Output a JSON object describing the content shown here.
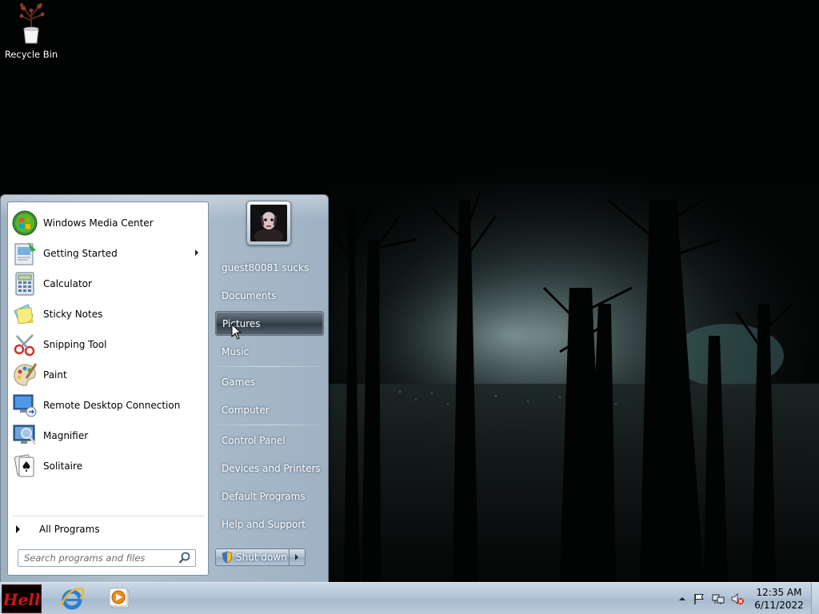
{
  "desktop": {
    "icons": [
      {
        "label": "Recycle Bin",
        "icon": "recycle-bin-icon"
      }
    ]
  },
  "start_menu": {
    "programs": [
      {
        "label": "Windows Media Center",
        "icon": "windows-media-center-icon"
      },
      {
        "label": "Getting Started",
        "icon": "getting-started-icon",
        "has_submenu": true
      },
      {
        "label": "Calculator",
        "icon": "calculator-icon"
      },
      {
        "label": "Sticky Notes",
        "icon": "sticky-notes-icon"
      },
      {
        "label": "Snipping Tool",
        "icon": "snipping-tool-icon"
      },
      {
        "label": "Paint",
        "icon": "paint-icon"
      },
      {
        "label": "Remote Desktop Connection",
        "icon": "remote-desktop-icon"
      },
      {
        "label": "Magnifier",
        "icon": "magnifier-icon"
      },
      {
        "label": "Solitaire",
        "icon": "solitaire-icon"
      }
    ],
    "all_programs_label": "All Programs",
    "search_placeholder": "Search programs and files",
    "user_name": "guest80081 sucks",
    "places": [
      {
        "label": "Documents"
      },
      {
        "label": "Pictures",
        "hovered": true
      },
      {
        "label": "Music"
      },
      {
        "label": "Games"
      },
      {
        "label": "Computer"
      },
      {
        "label": "Control Panel"
      },
      {
        "label": "Devices and Printers"
      },
      {
        "label": "Default Programs"
      },
      {
        "label": "Help and Support"
      }
    ],
    "shutdown_label": "Shut down"
  },
  "taskbar": {
    "start_button_text": "Hell",
    "pinned": [
      {
        "icon": "internet-explorer-icon"
      },
      {
        "icon": "windows-media-player-icon"
      }
    ],
    "tray": {
      "icons": [
        "show-hidden-icons-arrow",
        "action-center-flag-icon",
        "network-icon",
        "volume-muted-icon"
      ]
    },
    "clock": {
      "time": "12:35 AM",
      "date": "6/11/2022"
    }
  },
  "colors": {
    "start_menu_frame": "#a6b8c9",
    "taskbar": "#b3c5d8",
    "hover_item": "#3a4650",
    "start_button_red": "#d01414"
  }
}
